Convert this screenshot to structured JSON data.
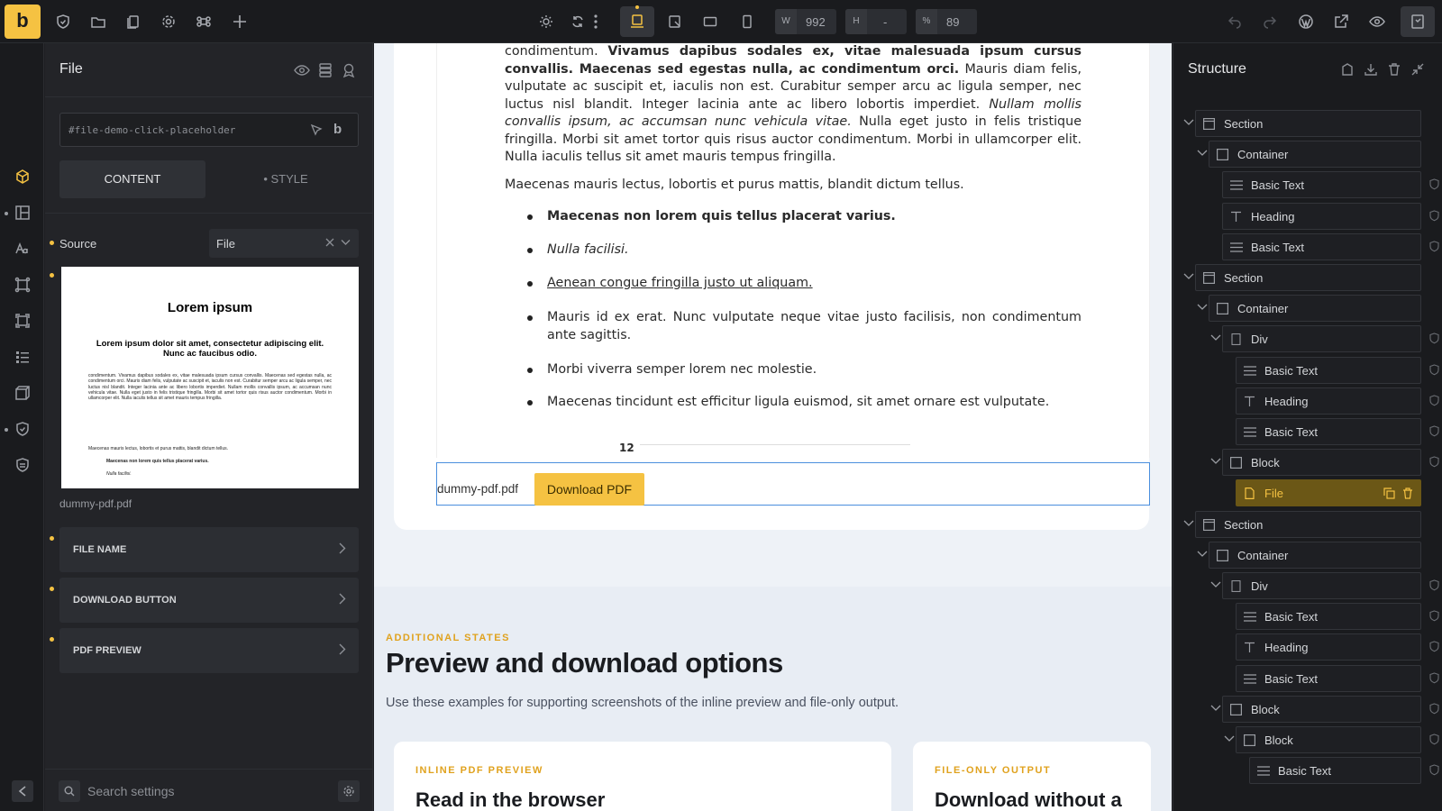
{
  "topbar": {
    "logo": "b",
    "width_label": "W",
    "width_value": "992",
    "height_label": "H",
    "height_value": "-",
    "zoom_label": "%",
    "zoom_value": "89"
  },
  "panel": {
    "title": "File",
    "selector_placeholder": "#file-demo-click-placeholder",
    "selector_badge": "b",
    "tab_content": "CONTENT",
    "tab_style": "• STYLE",
    "source_label": "Source",
    "source_value": "File",
    "thumbnail_title": "Lorem ipsum",
    "thumbnail_subtitle": "Lorem ipsum dolor sit amet, consectetur adipiscing elit. Nunc ac faucibus odio.",
    "filename": "dummy-pdf.pdf",
    "sections": [
      "FILE NAME",
      "DOWNLOAD BUTTON",
      "PDF PREVIEW"
    ],
    "search_placeholder": "Search settings"
  },
  "canvas": {
    "pdf_paragraph1": "condimentum. Vivamus dapibus sodales ex, vitae malesuada ipsum cursus convallis. Maecenas sed egestas nulla, ac condimentum orci. Mauris diam felis, vulputate ac suscipit et, iaculis non est. Curabitur semper arcu ac ligula semper, nec luctus nisl blandit. Integer lacinia ante ac libero lobortis imperdiet. Nullam mollis convallis ipsum, ac accumsan nunc vehicula vitae. Nulla eget justo in felis tristique fringilla. Morbi sit amet tortor quis risus auctor condimentum. Morbi in ullamcorper elit. Nulla iaculis tellus sit amet mauris tempus fringilla.",
    "pdf_paragraph2": "Maecenas mauris lectus, lobortis et purus mattis, blandit dictum tellus.",
    "pdf_list": [
      "Maecenas non lorem quis tellus placerat varius.",
      "Nulla facilisi.",
      "Aenean congue fringilla justo ut aliquam.",
      "Mauris id ex erat. Nunc vulputate neque vitae justo facilisis, non condimentum ante sagittis.",
      "Morbi viverra semper lorem nec molestie.",
      "Maecenas tincidunt est efficitur ligula euismod, sit amet ornare est vulputate."
    ],
    "pdf_page_number": "12",
    "file_name": "dummy-pdf.pdf",
    "download_label": "Download PDF",
    "eyebrow": "ADDITIONAL STATES",
    "heading": "Preview and download options",
    "subtext": "Use these examples for supporting screenshots of the inline preview and file-only output.",
    "card1_eyebrow": "INLINE PDF PREVIEW",
    "card1_title": "Read in the browser",
    "card2_eyebrow": "FILE-ONLY OUTPUT",
    "card2_title": "Download without a"
  },
  "structure": {
    "title": "Structure",
    "nodes": [
      {
        "label": "Section",
        "icon": "section-icon"
      },
      {
        "label": "Container",
        "icon": "container-icon"
      },
      {
        "label": "Basic Text",
        "icon": "text-lines-icon"
      },
      {
        "label": "Heading",
        "icon": "heading-icon"
      },
      {
        "label": "Basic Text",
        "icon": "text-lines-icon"
      },
      {
        "label": "Section",
        "icon": "section-icon"
      },
      {
        "label": "Container",
        "icon": "container-icon"
      },
      {
        "label": "Div",
        "icon": "div-icon"
      },
      {
        "label": "Basic Text",
        "icon": "text-lines-icon"
      },
      {
        "label": "Heading",
        "icon": "heading-icon"
      },
      {
        "label": "Basic Text",
        "icon": "text-lines-icon"
      },
      {
        "label": "Block",
        "icon": "block-icon"
      },
      {
        "label": "File",
        "icon": "file-icon"
      },
      {
        "label": "Section",
        "icon": "section-icon"
      },
      {
        "label": "Container",
        "icon": "container-icon"
      },
      {
        "label": "Div",
        "icon": "div-icon"
      },
      {
        "label": "Basic Text",
        "icon": "text-lines-icon"
      },
      {
        "label": "Heading",
        "icon": "heading-icon"
      },
      {
        "label": "Basic Text",
        "icon": "text-lines-icon"
      },
      {
        "label": "Block",
        "icon": "block-icon"
      },
      {
        "label": "Block",
        "icon": "block-icon"
      },
      {
        "label": "Basic Text",
        "icon": "text-lines-icon"
      }
    ]
  },
  "colors": {
    "accent": "#f5c242",
    "selected_node": "#6b5716",
    "focus_border": "#4b8fde"
  }
}
